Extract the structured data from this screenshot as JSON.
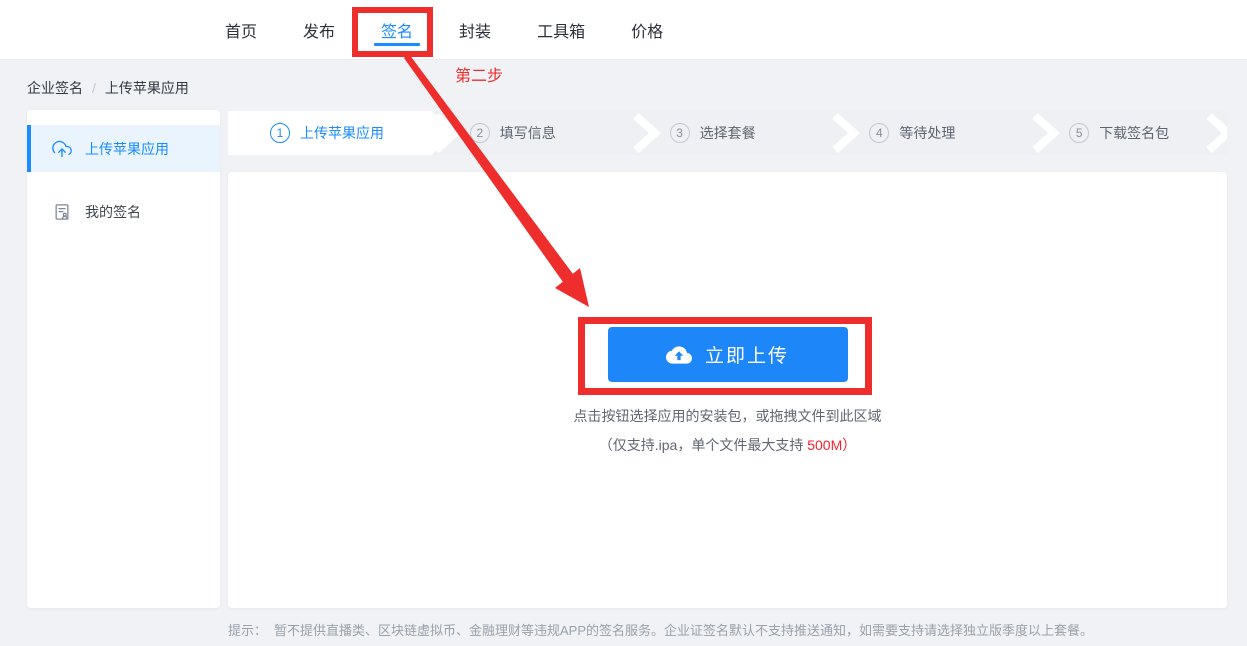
{
  "header": {
    "nav_items": [
      {
        "label": "首页",
        "active": false
      },
      {
        "label": "发布",
        "active": false
      },
      {
        "label": "签名",
        "active": true
      },
      {
        "label": "封装",
        "active": false
      },
      {
        "label": "工具箱",
        "active": false
      },
      {
        "label": "价格",
        "active": false
      }
    ]
  },
  "annotations": {
    "step_label": "第二步",
    "highlight_targets": [
      "签名 tab",
      "立即上传 button"
    ],
    "color": "#ee2d2d"
  },
  "breadcrumb": {
    "parent": "企业签名",
    "separator": "/",
    "current": "上传苹果应用"
  },
  "sidebar": {
    "items": [
      {
        "label": "上传苹果应用",
        "icon": "cloud-upload-icon",
        "active": true
      },
      {
        "label": "我的签名",
        "icon": "signature-document-icon",
        "active": false
      }
    ]
  },
  "steps": [
    {
      "num": "1",
      "label": "上传苹果应用",
      "active": true
    },
    {
      "num": "2",
      "label": "填写信息",
      "active": false
    },
    {
      "num": "3",
      "label": "选择套餐",
      "active": false
    },
    {
      "num": "4",
      "label": "等待处理",
      "active": false
    },
    {
      "num": "5",
      "label": "下载签名包",
      "active": false
    }
  ],
  "upload": {
    "button_label": "立即上传",
    "button_icon": "cloud-upload-icon",
    "hint_line1": "点击按钮选择应用的安装包，或拖拽文件到此区域",
    "hint_line2_prefix": "（仅支持.ipa，单个文件最大支持 ",
    "hint_line2_highlight": "500M",
    "hint_line2_suffix": "）"
  },
  "footer": {
    "tip_label": "提示：",
    "tip_text": "暂不提供直播类、区块链虚拟币、金融理财等违规APP的签名服务。企业证签名默认不支持推送通知，如需要支持请选择独立版季度以上套餐。"
  },
  "colors": {
    "accent_blue": "#1a8cff",
    "button_blue": "#1d87f9",
    "annotation_red": "#ee2d2d",
    "highlight_red": "#f5222d",
    "page_background": "#f0f2f5"
  }
}
